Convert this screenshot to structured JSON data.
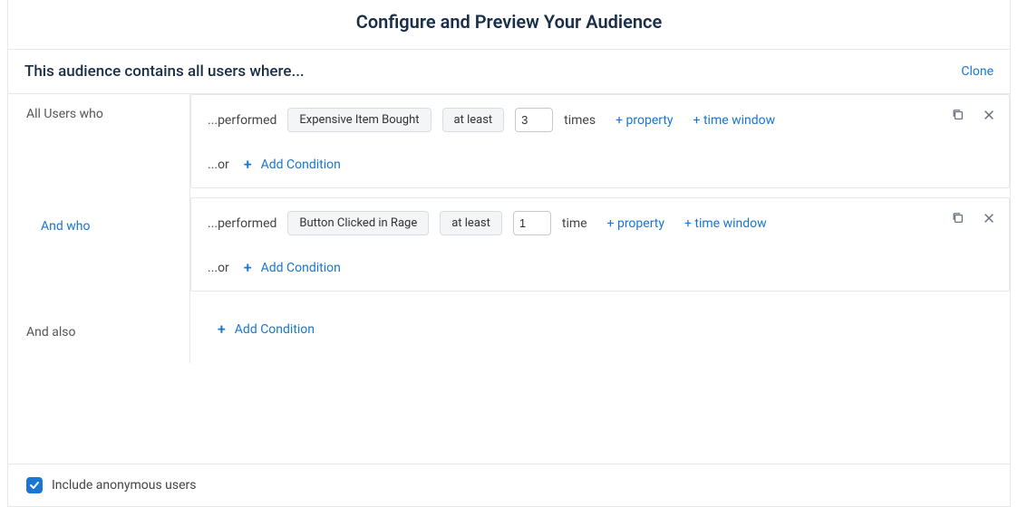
{
  "header": {
    "title": "Configure and Preview Your Audience"
  },
  "subheader": {
    "title": "This audience contains all users where...",
    "clone": "Clone"
  },
  "groups": [
    {
      "leftLabel": "All Users who",
      "leftLabelBlue": false,
      "condition": {
        "performed": "...performed",
        "event": "Expensive Item Bought",
        "comparator": "at least",
        "count": "3",
        "unit": "times",
        "propertyLink": "+ property",
        "timeWindowLink": "+ time window"
      },
      "orLabel": "...or",
      "addCondition": "Add Condition"
    },
    {
      "leftLabel": "And who",
      "leftLabelBlue": true,
      "condition": {
        "performed": "...performed",
        "event": "Button Clicked in Rage",
        "comparator": "at least",
        "count": "1",
        "unit": "time",
        "propertyLink": "+ property",
        "timeWindowLink": "+ time window"
      },
      "orLabel": "...or",
      "addCondition": "Add Condition"
    }
  ],
  "andAlso": {
    "label": "And also",
    "addCondition": "Add Condition"
  },
  "footer": {
    "checked": true,
    "label": "Include anonymous users"
  }
}
